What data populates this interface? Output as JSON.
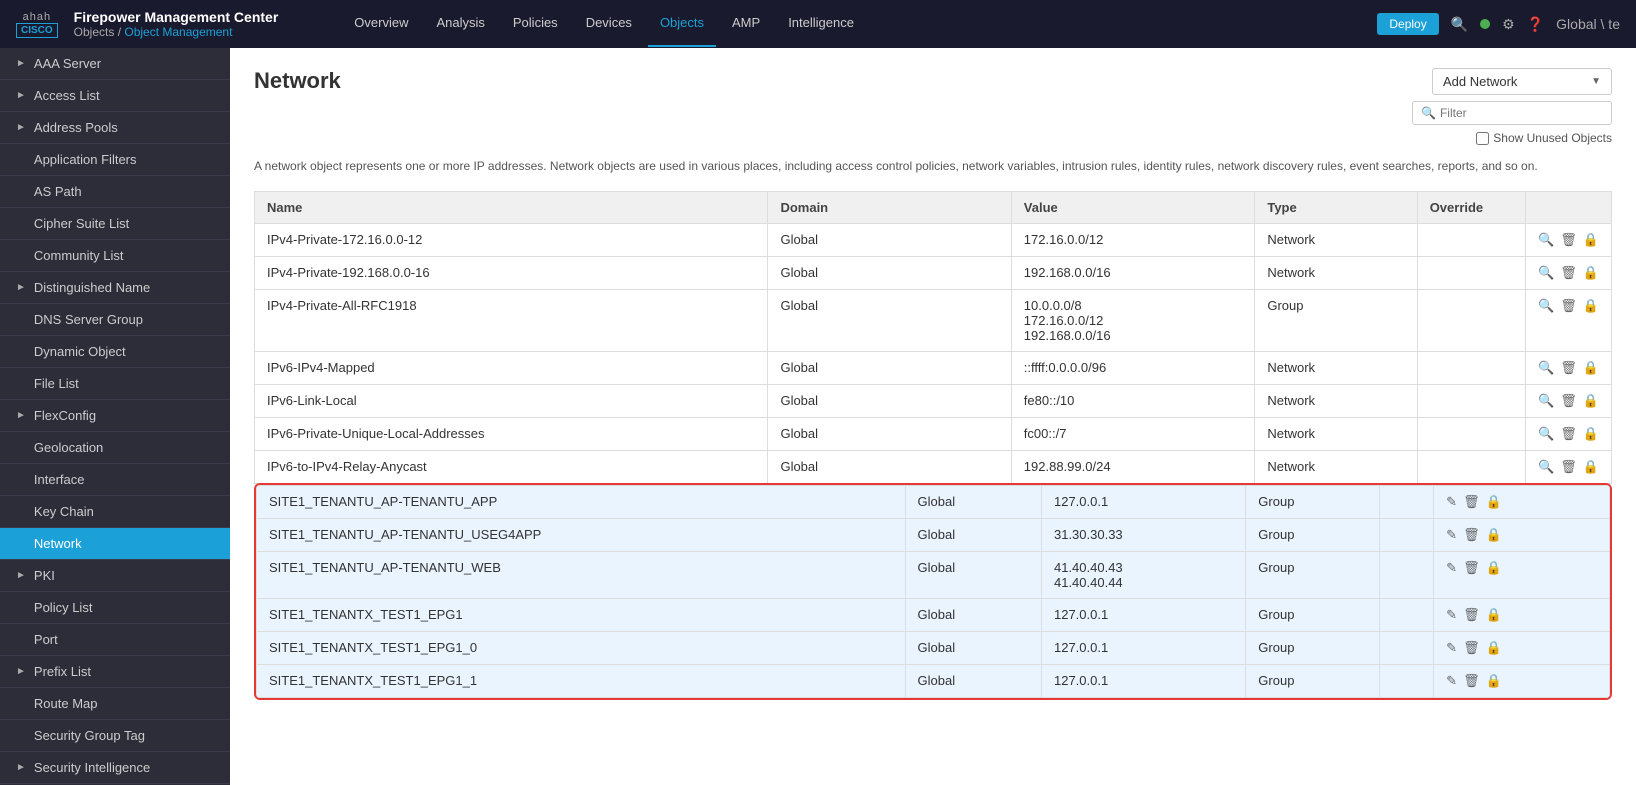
{
  "app": {
    "logo_line1": "ahah",
    "logo_line2": "CISCO",
    "title": "Firepower Management Center",
    "breadcrumb_parent": "Objects",
    "breadcrumb_current": "Object Management"
  },
  "nav": {
    "links": [
      "Overview",
      "Analysis",
      "Policies",
      "Devices",
      "Objects",
      "AMP",
      "Intelligence"
    ],
    "active": "Objects",
    "deploy_label": "Deploy",
    "user_label": "Global \\ te"
  },
  "sidebar": {
    "items": [
      {
        "label": "AAA Server",
        "has_chevron": true,
        "active": false
      },
      {
        "label": "Access List",
        "has_chevron": true,
        "active": false
      },
      {
        "label": "Address Pools",
        "has_chevron": true,
        "active": false
      },
      {
        "label": "Application Filters",
        "has_chevron": false,
        "active": false
      },
      {
        "label": "AS Path",
        "has_chevron": false,
        "active": false
      },
      {
        "label": "Cipher Suite List",
        "has_chevron": false,
        "active": false
      },
      {
        "label": "Community List",
        "has_chevron": false,
        "active": false
      },
      {
        "label": "Distinguished Name",
        "has_chevron": true,
        "active": false
      },
      {
        "label": "DNS Server Group",
        "has_chevron": false,
        "active": false
      },
      {
        "label": "Dynamic Object",
        "has_chevron": false,
        "active": false
      },
      {
        "label": "File List",
        "has_chevron": false,
        "active": false
      },
      {
        "label": "FlexConfig",
        "has_chevron": true,
        "active": false
      },
      {
        "label": "Geolocation",
        "has_chevron": false,
        "active": false
      },
      {
        "label": "Interface",
        "has_chevron": false,
        "active": false
      },
      {
        "label": "Key Chain",
        "has_chevron": false,
        "active": false
      },
      {
        "label": "Network",
        "has_chevron": false,
        "active": true
      },
      {
        "label": "PKI",
        "has_chevron": true,
        "active": false
      },
      {
        "label": "Policy List",
        "has_chevron": false,
        "active": false
      },
      {
        "label": "Port",
        "has_chevron": false,
        "active": false
      },
      {
        "label": "Prefix List",
        "has_chevron": true,
        "active": false
      },
      {
        "label": "Route Map",
        "has_chevron": false,
        "active": false
      },
      {
        "label": "Security Group Tag",
        "has_chevron": false,
        "active": false
      },
      {
        "label": "Security Intelligence",
        "has_chevron": true,
        "active": false
      }
    ]
  },
  "main": {
    "title": "Network",
    "add_button_label": "Add Network",
    "filter_placeholder": "Filter",
    "show_unused_label": "Show Unused Objects",
    "description": "A network object represents one or more IP addresses. Network objects are used in various places, including access control policies, network variables, intrusion rules, identity rules, network discovery rules, event searches, reports, and so on.",
    "table": {
      "columns": [
        "Name",
        "Domain",
        "Value",
        "Type",
        "Override",
        ""
      ],
      "rows": [
        {
          "name": "IPv4-Private-172.16.0.0-12",
          "domain": "Global",
          "value": "172.16.0.0/12",
          "type": "Network",
          "highlighted": false
        },
        {
          "name": "IPv4-Private-192.168.0.0-16",
          "domain": "Global",
          "value": "192.168.0.0/16",
          "type": "Network",
          "highlighted": false
        },
        {
          "name": "IPv4-Private-All-RFC1918",
          "domain": "Global",
          "value": "10.0.0.0/8\n172.16.0.0/12\n192.168.0.0/16",
          "type": "Group",
          "highlighted": false
        },
        {
          "name": "IPv6-IPv4-Mapped",
          "domain": "Global",
          "value": "::ffff:0.0.0.0/96",
          "type": "Network",
          "highlighted": false
        },
        {
          "name": "IPv6-Link-Local",
          "domain": "Global",
          "value": "fe80::/10",
          "type": "Network",
          "highlighted": false
        },
        {
          "name": "IPv6-Private-Unique-Local-Addresses",
          "domain": "Global",
          "value": "fc00::/7",
          "type": "Network",
          "highlighted": false
        },
        {
          "name": "IPv6-to-IPv4-Relay-Anycast",
          "domain": "Global",
          "value": "192.88.99.0/24",
          "type": "Network",
          "highlighted": false
        },
        {
          "name": "SITE1_TENANTU_AP-TENANTU_APP",
          "domain": "Global",
          "value": "127.0.0.1",
          "type": "Group",
          "highlighted": true
        },
        {
          "name": "SITE1_TENANTU_AP-TENANTU_USEG4APP",
          "domain": "Global",
          "value": "31.30.30.33",
          "type": "Group",
          "highlighted": true
        },
        {
          "name": "SITE1_TENANTU_AP-TENANTU_WEB",
          "domain": "Global",
          "value": "41.40.40.43\n41.40.40.44",
          "type": "Group",
          "highlighted": true
        },
        {
          "name": "SITE1_TENANTX_TEST1_EPG1",
          "domain": "Global",
          "value": "127.0.0.1",
          "type": "Group",
          "highlighted": true
        },
        {
          "name": "SITE1_TENANTX_TEST1_EPG1_0",
          "domain": "Global",
          "value": "127.0.0.1",
          "type": "Group",
          "highlighted": true
        },
        {
          "name": "SITE1_TENANTX_TEST1_EPG1_1",
          "domain": "Global",
          "value": "127.0.0.1",
          "type": "Group",
          "highlighted": true
        }
      ]
    }
  }
}
